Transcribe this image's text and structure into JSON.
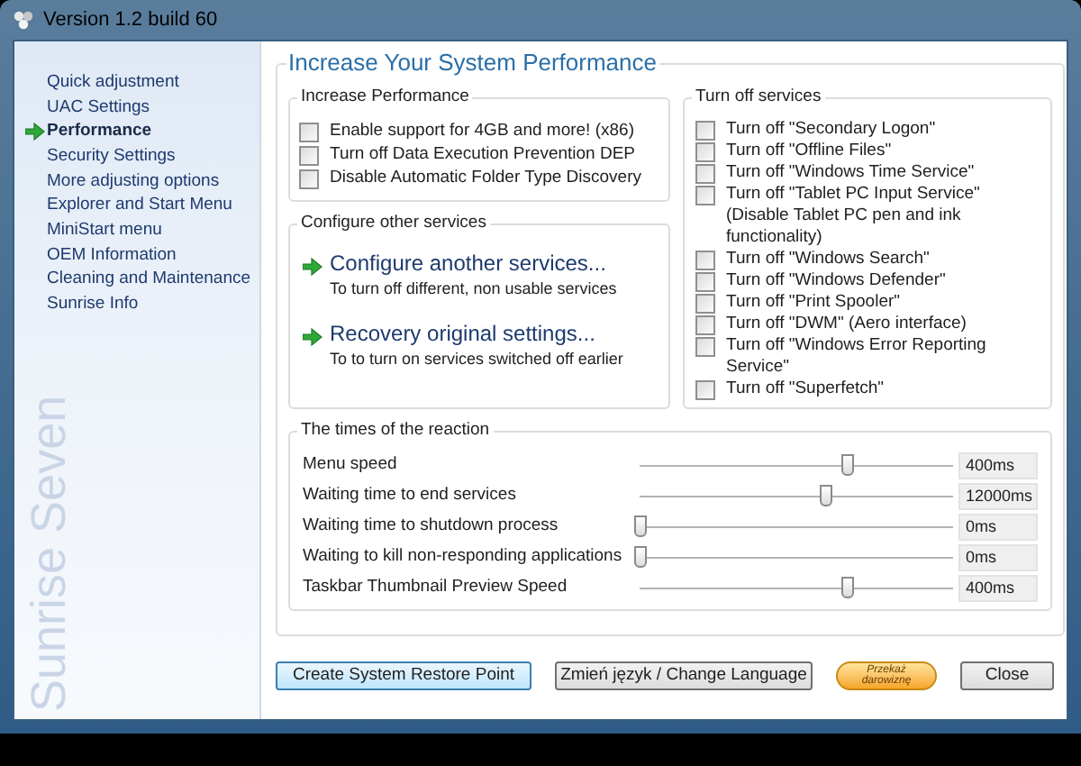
{
  "window": {
    "title": "Version 1.2 build 60"
  },
  "sidebar": {
    "items": [
      {
        "label": "Quick adjustment",
        "selected": false
      },
      {
        "label": "UAC Settings",
        "selected": false
      },
      {
        "label": "Performance",
        "selected": true
      },
      {
        "label": "Security Settings",
        "selected": false
      },
      {
        "label": "More adjusting options",
        "selected": false
      },
      {
        "label": "Explorer and Start Menu",
        "selected": false
      },
      {
        "label": "MiniStart menu",
        "selected": false
      },
      {
        "label": "OEM Information",
        "selected": false
      },
      {
        "label": "Cleaning and Maintenance",
        "selected": false
      },
      {
        "label": "Sunrise Info",
        "selected": false
      }
    ],
    "brand": "Sunrise Seven"
  },
  "main": {
    "title": "Increase Your System Performance"
  },
  "increase_performance": {
    "title": "Increase Performance",
    "options": [
      {
        "label": "Enable support for 4GB and more! (x86)",
        "checked": false
      },
      {
        "label": "Turn off Data Execution Prevention DEP",
        "checked": false
      },
      {
        "label": "Disable Automatic Folder Type Discovery",
        "checked": false
      }
    ]
  },
  "configure_services": {
    "title": "Configure other services",
    "links": [
      {
        "title": "Configure another services...",
        "subtitle": "To turn off different, non usable services"
      },
      {
        "title": "Recovery original settings...",
        "subtitle": "To to turn on services switched off earlier"
      }
    ]
  },
  "turn_off_services": {
    "title": "Turn off services",
    "options": [
      {
        "label": "Turn off \"Secondary Logon\"",
        "checked": false
      },
      {
        "label": "Turn off \"Offline Files\"",
        "checked": false
      },
      {
        "label": "Turn off \"Windows Time Service\"",
        "checked": false
      },
      {
        "label": "Turn off \"Tablet PC Input Service\" (Disable Tablet PC pen and ink functionality)",
        "checked": false
      },
      {
        "label": "Turn off \"Windows Search\"",
        "checked": false
      },
      {
        "label": "Turn off \"Windows Defender\"",
        "checked": false
      },
      {
        "label": "Turn off \"Print Spooler\"",
        "checked": false
      },
      {
        "label": "Turn off \"DWM\" (Aero interface)",
        "checked": false
      },
      {
        "label": "Turn off \"Windows Error Reporting Service\"",
        "checked": false
      },
      {
        "label": "Turn off \"Superfetch\"",
        "checked": false
      }
    ]
  },
  "reaction_times": {
    "title": "The times of the reaction",
    "rows": [
      {
        "label": "Menu speed",
        "level": 0.66,
        "reading": "400ms"
      },
      {
        "label": "Waiting time to end services",
        "level": 0.59,
        "reading": "12000ms"
      },
      {
        "label": "Waiting time to shutdown process",
        "level": 0,
        "reading": "0ms"
      },
      {
        "label": "Waiting to kill non-responding applications",
        "level": 0,
        "reading": "0ms"
      },
      {
        "label": "Taskbar Thumbnail Preview Speed",
        "level": 0.66,
        "reading": "400ms"
      }
    ]
  },
  "buttons": [
    {
      "label": "Create System Restore Point",
      "kind": "default"
    },
    {
      "label": "Zmień język / Change Language",
      "kind": "normal"
    },
    {
      "label": "Przekaż darowiznę",
      "kind": "donate"
    },
    {
      "label": "Close",
      "kind": "normal"
    }
  ]
}
